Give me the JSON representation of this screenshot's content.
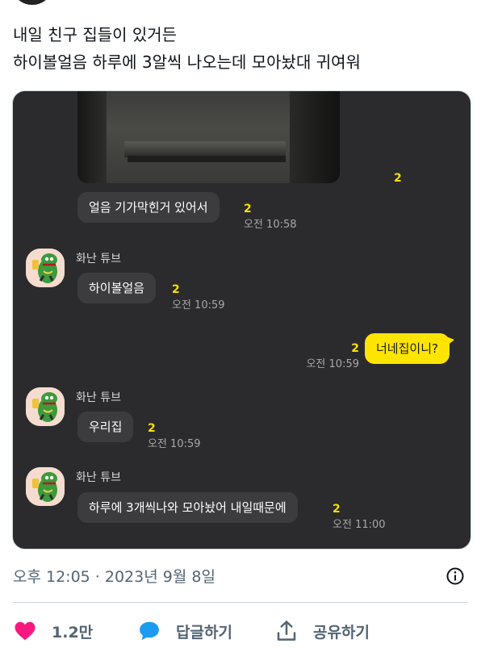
{
  "tweet": {
    "lines": [
      "내일 친구 집들이 있거든",
      "하이볼얼음 하루에 3알씩 나오는데 모아놨대 귀여워"
    ],
    "timestamp": "오후 12:05 · 2023년 9월 8일"
  },
  "chat": {
    "photo_count": "2",
    "messages": [
      {
        "text": "얼음 기가막힌거 있어서",
        "count": "2",
        "time": "오전 10:58"
      },
      {
        "sender": "화난 튜브",
        "text": "하이볼얼음",
        "count": "2",
        "time": "오전 10:59"
      },
      {
        "text": "너네집이니?",
        "count": "2",
        "time": "오전 10:59",
        "mine": true
      },
      {
        "sender": "화난 튜브",
        "text": "우리집",
        "count": "2",
        "time": "오전 10:59"
      },
      {
        "sender": "화난 튜브",
        "text": "하루에 3개씩나와 모아놨어 내일때문에",
        "count": "2",
        "time": "오전 11:00"
      }
    ]
  },
  "actions": {
    "like_count": "1.2만",
    "reply_label": "답글하기",
    "share_label": "공유하기"
  },
  "colors": {
    "chat_bg": "#2b2b2d",
    "bubble_other": "#3c3c3f",
    "bubble_mine": "#fee500",
    "unread_count": "#f9e000",
    "like": "#f91880",
    "reply": "#1d9bf0"
  },
  "icons": [
    "info-icon",
    "heart-icon",
    "reply-icon",
    "share-icon"
  ]
}
